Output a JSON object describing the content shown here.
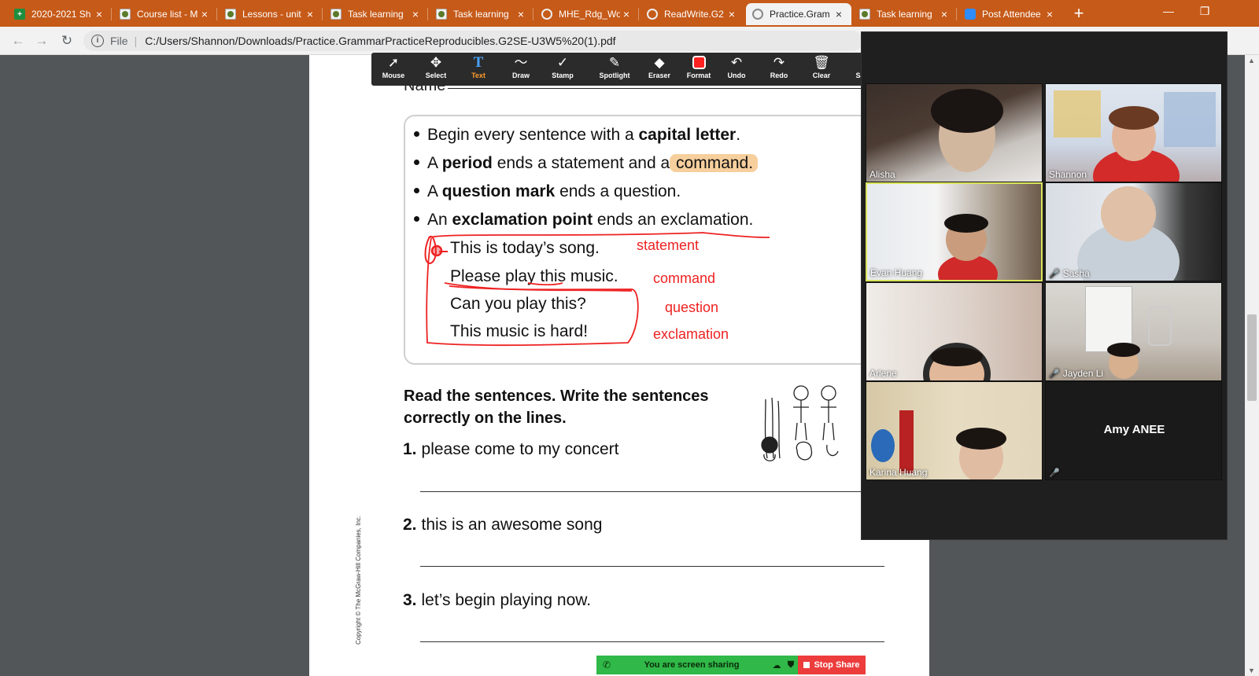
{
  "browser": {
    "tabs": [
      {
        "label": "2020-2021 Sh",
        "icon": "sheets-icon",
        "active": false
      },
      {
        "label": "Course list - M",
        "icon": "doc-icon",
        "active": false
      },
      {
        "label": "Lessons - unit",
        "icon": "doc-icon",
        "active": false
      },
      {
        "label": "Task learning",
        "icon": "doc-icon",
        "active": false
      },
      {
        "label": "Task learning",
        "icon": "doc-icon",
        "active": false
      },
      {
        "label": "MHE_Rdg_Wo",
        "icon": "globe-icon",
        "active": false
      },
      {
        "label": "ReadWrite.G2",
        "icon": "globe-icon",
        "active": false
      },
      {
        "label": "Practice.Gram",
        "icon": "globe-icon",
        "active": true
      },
      {
        "label": "Task learning",
        "icon": "doc-icon",
        "active": false
      },
      {
        "label": "Post Attendee",
        "icon": "zoom-icon",
        "active": false
      }
    ],
    "new_tab_glyph": "+",
    "window_controls": {
      "minimize": "—",
      "restore": "❐"
    },
    "address": {
      "info_glyph": "i",
      "scheme_label": "File",
      "url": "C:/Users/Shannon/Downloads/Practice.GrammarPracticeReproducibles.G2SE-U3W5%20(1).pdf"
    },
    "accent_color": "#c65a18"
  },
  "annotation_toolbar": {
    "tools": [
      {
        "label": "Mouse",
        "glyph": "➚",
        "icon": "mouse-pointer-icon",
        "active": false
      },
      {
        "label": "Select",
        "glyph": "✥",
        "icon": "select-move-icon",
        "active": false
      },
      {
        "label": "Text",
        "glyph": "T",
        "icon": "text-icon",
        "active": true
      },
      {
        "label": "Draw",
        "glyph": "〜",
        "icon": "draw-icon",
        "active": false
      },
      {
        "label": "Stamp",
        "glyph": "✓",
        "icon": "stamp-icon",
        "active": false
      },
      {
        "label": "Spotlight",
        "glyph": "✎",
        "icon": "spotlight-icon",
        "active": false
      },
      {
        "label": "Eraser",
        "glyph": "◆",
        "icon": "eraser-icon",
        "active": false
      },
      {
        "label": "Format",
        "glyph": "",
        "icon": "format-color-icon",
        "active": false
      },
      {
        "label": "Undo",
        "glyph": "↶",
        "icon": "undo-icon",
        "active": false
      },
      {
        "label": "Redo",
        "glyph": "↷",
        "icon": "redo-icon",
        "active": false
      },
      {
        "label": "Clear",
        "glyph": "🗑",
        "icon": "trash-icon",
        "active": false
      },
      {
        "label": "Save",
        "glyph": "⤓",
        "icon": "save-icon",
        "active": false
      }
    ],
    "close_glyph": "×",
    "active_color": "#ff9d2e"
  },
  "worksheet": {
    "name_label": "Name",
    "rules": [
      {
        "pre": "Begin every sentence with a ",
        "bold": "capital letter",
        "post": "."
      },
      {
        "pre": "A ",
        "bold": "period",
        "post": " ends a statement and a",
        "highlight": " command."
      },
      {
        "pre": "A ",
        "bold": "question mark",
        "post": " ends a question."
      },
      {
        "pre": "An ",
        "bold": "exclamation point",
        "post": " ends an exclamation."
      }
    ],
    "examples": [
      "This is today’s song.",
      "Please play this music.",
      "Can you play this?",
      "This music is hard!"
    ],
    "instructions": "Read the sentences. Write the sentences correctly on the lines.",
    "items": [
      {
        "num": "1.",
        "text": "please come to my concert"
      },
      {
        "num": "2.",
        "text": "this is an awesome song"
      },
      {
        "num": "3.",
        "text": "let’s begin playing now."
      }
    ],
    "copyright": "Copyright © The McGraw-Hill Companies, Inc.",
    "ink_annotations": [
      "statement",
      "command",
      "question",
      "exclamation"
    ],
    "ink_color": "#e22222"
  },
  "zoom": {
    "participants": [
      {
        "name": "Alisha",
        "muted": false,
        "speaking": false
      },
      {
        "name": "Shannon",
        "muted": false,
        "speaking": false
      },
      {
        "name": "Evan Huang",
        "muted": false,
        "speaking": true
      },
      {
        "name": "Sasha",
        "muted": true,
        "speaking": false
      },
      {
        "name": "Arlene",
        "muted": false,
        "speaking": false
      },
      {
        "name": "Jayden Li",
        "muted": true,
        "speaking": false
      },
      {
        "name": "Karina Huang",
        "muted": false,
        "speaking": false
      },
      {
        "name": "Amy ANEE",
        "muted": true,
        "speaking": false,
        "video_off": true
      }
    ],
    "mic_muted_glyph": "🎤",
    "speaking_border_color": "#d9e45a"
  },
  "share_bar": {
    "status_text": "You are screen sharing",
    "stop_label": "Stop Share",
    "status_color": "#30b848",
    "stop_color": "#ec3c3c"
  }
}
